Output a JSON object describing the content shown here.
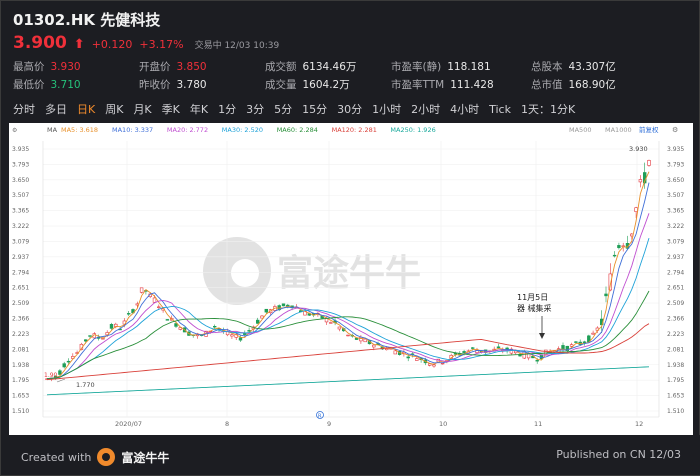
{
  "header": {
    "title": "01302.HK 先健科技",
    "price": "3.900",
    "arrow": "⬆",
    "change": "+0.120",
    "change_pct": "+3.17%",
    "status": "交易中 12/03 10:39"
  },
  "stats": [
    {
      "label": "最高价",
      "value": "3.930",
      "tone": "red"
    },
    {
      "label": "开盘价",
      "value": "3.850",
      "tone": "red"
    },
    {
      "label": "成交额",
      "value": "6134.46万",
      "tone": ""
    },
    {
      "label": "市盈率(静)",
      "value": "118.181",
      "tone": ""
    },
    {
      "label": "总股本",
      "value": "43.307亿",
      "tone": ""
    },
    {
      "label": "最低价",
      "value": "3.710",
      "tone": "grn"
    },
    {
      "label": "昨收价",
      "value": "3.780",
      "tone": ""
    },
    {
      "label": "成交量",
      "value": "1604.2万",
      "tone": ""
    },
    {
      "label": "市盈率TTM",
      "value": "111.428",
      "tone": ""
    },
    {
      "label": "总市值",
      "value": "168.90亿",
      "tone": ""
    }
  ],
  "tabs": [
    "分时",
    "多日",
    "日K",
    "周K",
    "月K",
    "季K",
    "年K",
    "1分",
    "3分",
    "5分",
    "15分",
    "30分",
    "1小时",
    "2小时",
    "4小时",
    "Tick",
    "1天：1分K"
  ],
  "active_tab": "日K",
  "chart": {
    "ma_labels": [
      {
        "text": "MA5: 3.618",
        "color": "#e8902a"
      },
      {
        "text": "MA10: 3.337",
        "color": "#3f6fd8"
      },
      {
        "text": "MA20: 2.772",
        "color": "#c04fd0"
      },
      {
        "text": "MA30: 2.520",
        "color": "#1fa2d8"
      },
      {
        "text": "MA60: 2.284",
        "color": "#2a8f3a"
      },
      {
        "text": "MA120: 2.281",
        "color": "#d9413a"
      },
      {
        "text": "MA250: 1.926",
        "color": "#1aa99c"
      }
    ],
    "ma_prefix": "MA",
    "ma_extra": "MA500",
    "ma_extra2": "MA1000",
    "restore_label": "前复权",
    "y_ticks": [
      "3.935",
      "3.793",
      "3.650",
      "3.507",
      "3.365",
      "3.222",
      "3.079",
      "2.937",
      "2.794",
      "2.651",
      "2.509",
      "2.366",
      "2.223",
      "2.081",
      "1.938",
      "1.795",
      "1.653",
      "1.510"
    ],
    "x_ticks": [
      "2020/07",
      "8",
      "9",
      "10",
      "11",
      "12"
    ],
    "high_marker": "3.930",
    "low_marker": "1.770",
    "start_marker": "1.90",
    "annotation_line1": "11月5日",
    "annotation_line2": "器 械集采",
    "watermark": "富途牛牛",
    "colors": {
      "up": "#e4363d",
      "down": "#1f9e57"
    }
  },
  "chart_data": {
    "type": "line",
    "title": "",
    "xlabel": "",
    "ylabel": "",
    "x": [
      "2020/07",
      "8",
      "9",
      "10",
      "11",
      "12"
    ],
    "ylim": [
      1.51,
      3.935
    ],
    "series": [
      {
        "values": [
          1.8,
          2.45,
          2.3,
          2.05,
          2.15,
          3.9
        ]
      }
    ]
  },
  "footer": {
    "created_with": "Created with",
    "brand": "富途牛牛",
    "published": "Published on CN 12/03"
  }
}
